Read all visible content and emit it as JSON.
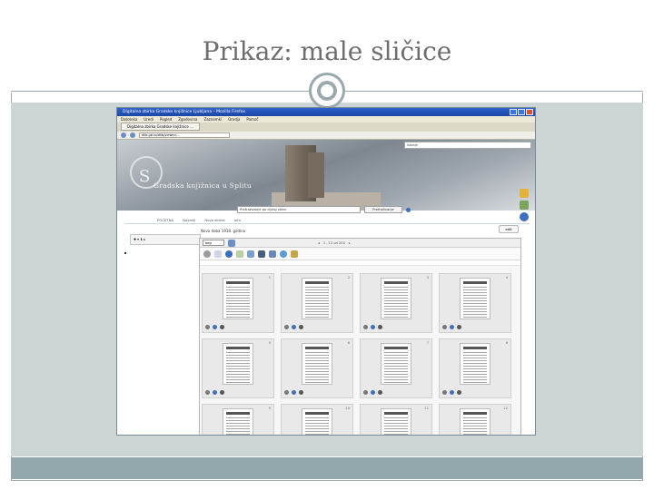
{
  "slide": {
    "title": "Prikaz: male sličice"
  },
  "browser": {
    "window_title": "Digitalna zbirka Gradske knjižnice Ljubljana – Mozilla Firefox",
    "menu": [
      "Datoteka",
      "Uredi",
      "Pogled",
      "Zgodovina",
      "Zaznamki",
      "Orodja",
      "Pomoč"
    ],
    "tab_label": "Digitalna zbirka Gradske knjižnice ...",
    "url": "dlib.gkl.si/dlib/viewer/…",
    "banner_search_placeholder": "Iskanje"
  },
  "site": {
    "logo_text": "Gradska knjižnica u Splitu",
    "search_placeholder": "Pretraživanje po cijeloj zbirci",
    "search_button": "Pretraživanje",
    "nav": [
      "POČETNA",
      "Novosti",
      "Nove zbirke",
      "Info"
    ],
    "viewer_title": "Novo doba 1918. godina",
    "edit_label": "edit",
    "view_select": "beg",
    "pager_text": "1 - 12 od 200",
    "thumbnails": [
      "1",
      "2",
      "3",
      "4",
      "5",
      "6",
      "7",
      "8",
      "9",
      "10",
      "11",
      "12"
    ]
  },
  "colors": {
    "title": "#6e6e6e",
    "panel": "#cdd4d6",
    "bar": "#92a8aa",
    "frame": "#9aa9ad"
  }
}
